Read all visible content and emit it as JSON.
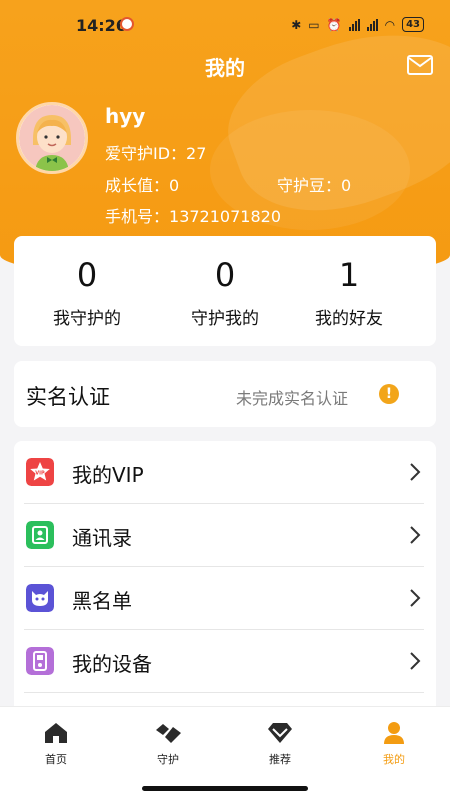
{
  "status_bar": {
    "time": "14:26",
    "battery": "43"
  },
  "header": {
    "title": "我的"
  },
  "profile": {
    "username": "hyy",
    "id_label": "爱守护ID：",
    "id_value": "27",
    "growth_label": "成长值：",
    "growth_value": "0",
    "beans_label": "守护豆：",
    "beans_value": "0",
    "phone_label": "手机号：",
    "phone_value": "13721071820"
  },
  "stats": [
    {
      "value": "0",
      "label": "我守护的"
    },
    {
      "value": "0",
      "label": "守护我的"
    },
    {
      "value": "1",
      "label": "我的好友"
    }
  ],
  "verification": {
    "title": "实名认证",
    "status": "未完成实名认证",
    "icon": "warning-icon",
    "color": "#f2a51a"
  },
  "menu": [
    {
      "label": "我的VIP",
      "icon": "vip-icon",
      "color": "#ee4444"
    },
    {
      "label": "通讯录",
      "icon": "contacts-icon",
      "color": "#2bbf5c"
    },
    {
      "label": "黑名单",
      "icon": "blacklist-icon",
      "color": "#5b53d6"
    },
    {
      "label": "我的设备",
      "icon": "device-icon",
      "color": "#b46fd8"
    }
  ],
  "tabbar": [
    {
      "label": "首页",
      "icon": "home-icon"
    },
    {
      "label": "守护",
      "icon": "guard-icon"
    },
    {
      "label": "推荐",
      "icon": "recommend-icon"
    },
    {
      "label": "我的",
      "icon": "profile-icon",
      "active": true
    }
  ],
  "colors": {
    "primary": "#f7a21c",
    "active_tab": "#f39c12"
  }
}
